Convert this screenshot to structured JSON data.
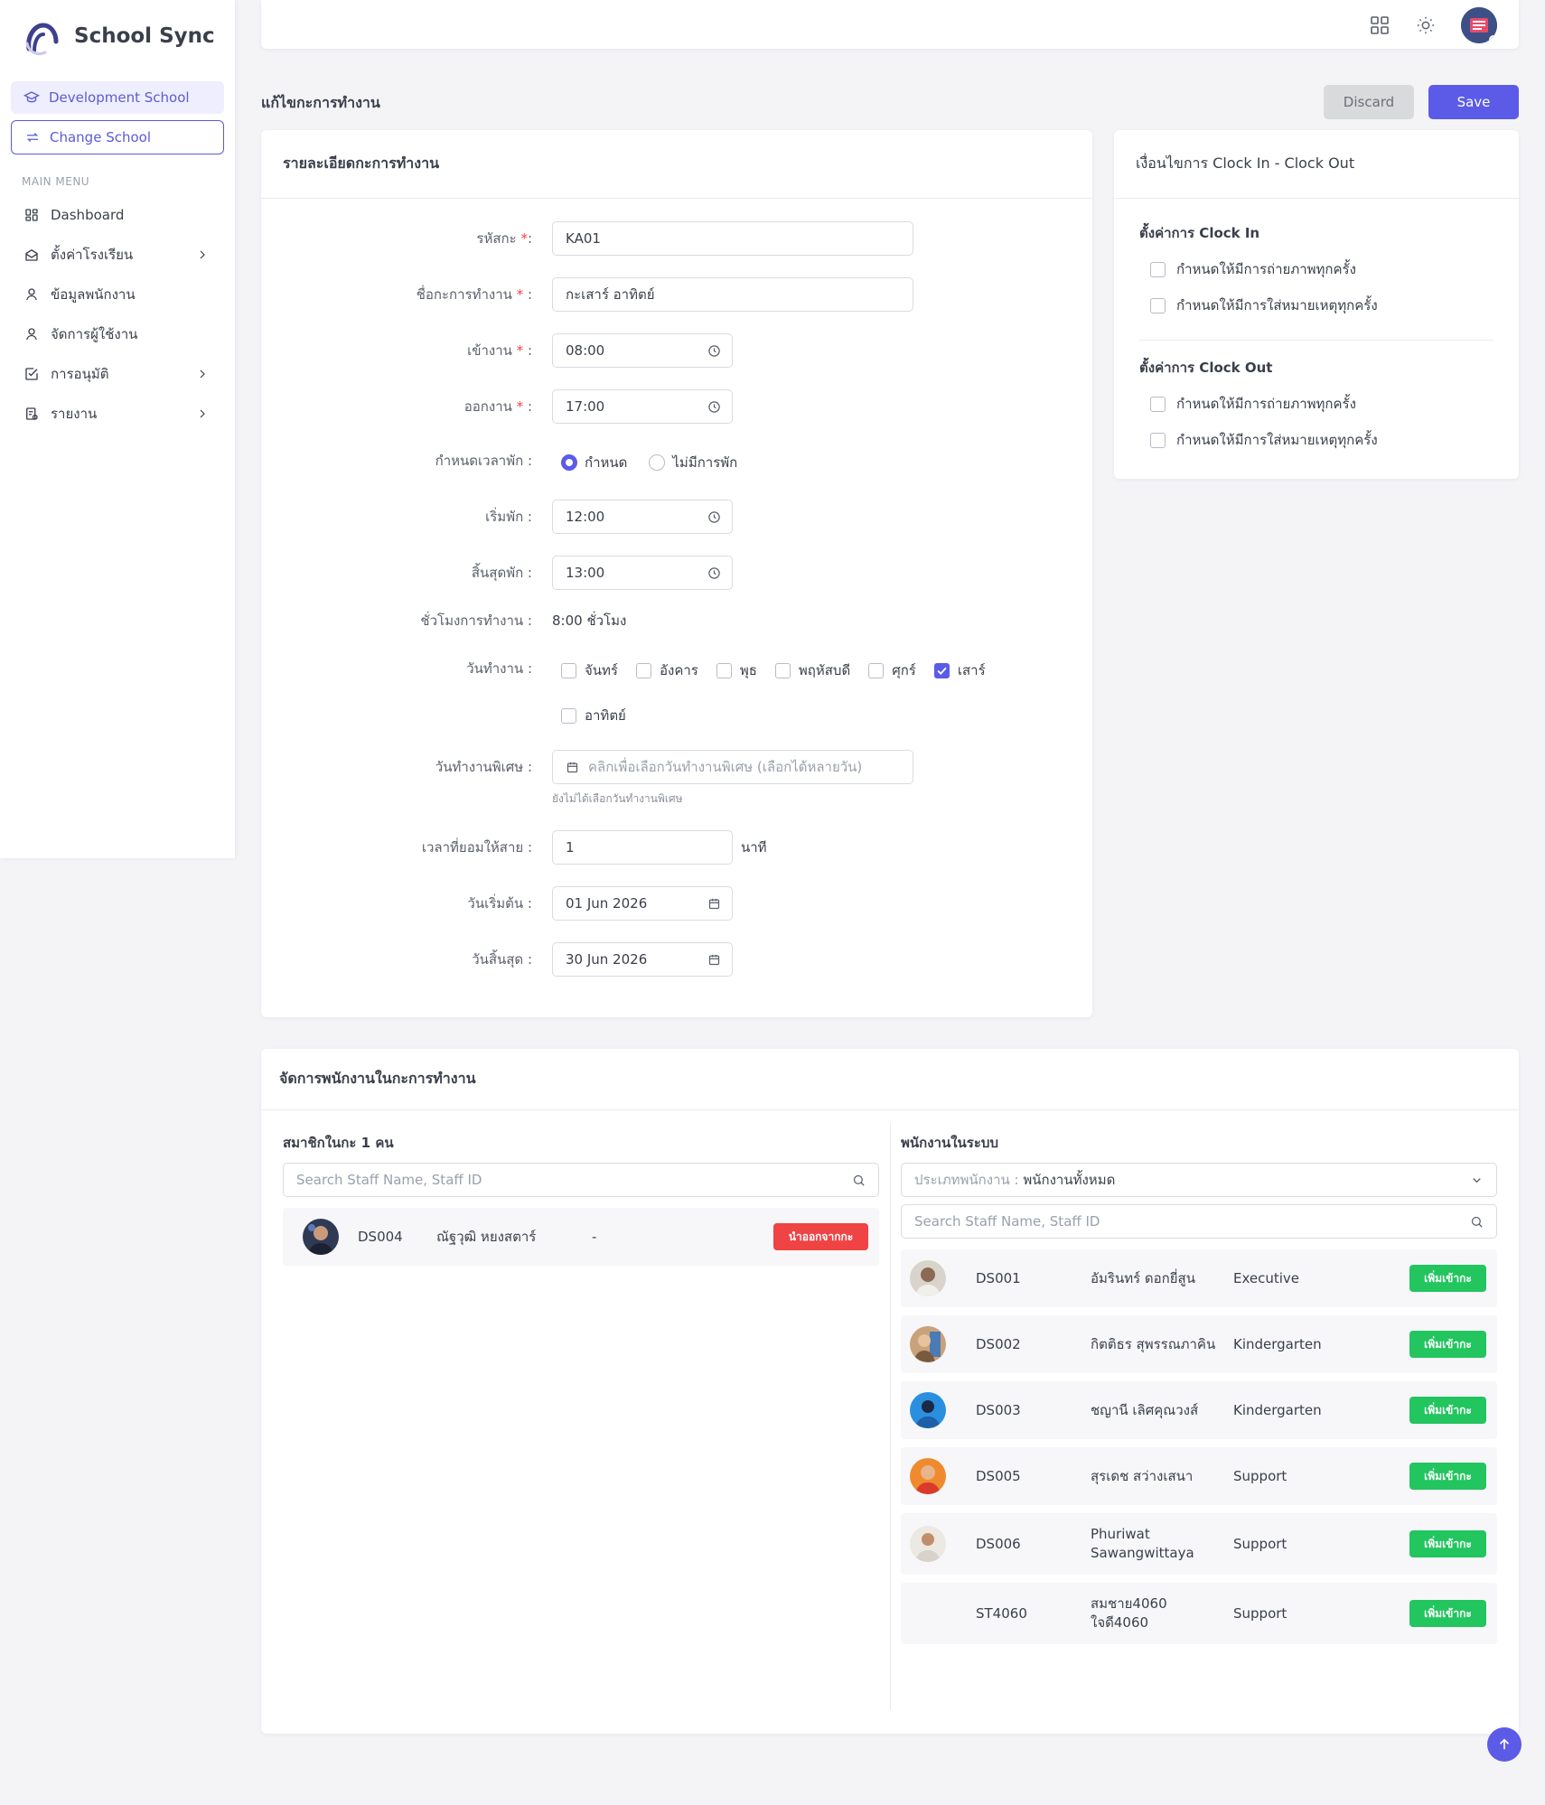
{
  "brand": {
    "name": "School Sync"
  },
  "sidebar": {
    "school": "Development School",
    "change_school": "Change School",
    "menu_heading": "MAIN MENU",
    "items": [
      {
        "label": "Dashboard"
      },
      {
        "label": "ตั้งค่าโรงเรียน"
      },
      {
        "label": "ข้อมูลพนักงาน"
      },
      {
        "label": "จัดการผู้ใช้งาน"
      },
      {
        "label": "การอนุมัติ"
      },
      {
        "label": "รายงาน"
      }
    ]
  },
  "header": {
    "title": "แก้ไขกะการทำงาน",
    "discard": "Discard",
    "save": "Save"
  },
  "details": {
    "title": "รายละเอียดกะการทำงาน",
    "code_label": "รหัสกะ",
    "code_value": "KA01",
    "name_label": "ชื่อกะการทำงาน",
    "name_value": "กะเสาร์ อาทิตย์",
    "start_label": "เข้างาน",
    "start_value": "08:00",
    "end_label": "ออกงาน",
    "end_value": "17:00",
    "break_label": "กำหนดเวลาพัก :",
    "break_opt_set": "กำหนด",
    "break_opt_none": "ไม่มีการพัก",
    "break_start_label": "เริ่มพัก :",
    "break_start_value": "12:00",
    "break_end_label": "สิ้นสุดพัก :",
    "break_end_value": "13:00",
    "hours_label": "ชั่วโมงการทำงาน :",
    "hours_value": "8:00 ชั่วโมง",
    "days_label": "วันทำงาน :",
    "days": [
      {
        "label": "จันทร์",
        "checked": false
      },
      {
        "label": "อังคาร",
        "checked": false
      },
      {
        "label": "พุธ",
        "checked": false
      },
      {
        "label": "พฤหัสบดี",
        "checked": false
      },
      {
        "label": "ศุกร์",
        "checked": false
      },
      {
        "label": "เสาร์",
        "checked": true
      },
      {
        "label": "อาทิตย์",
        "checked": false
      }
    ],
    "special_label": "วันทำงานพิเศษ :",
    "special_placeholder": "คลิกเพื่อเลือกวันทำงานพิเศษ (เลือกได้หลายวัน)",
    "special_hint": "ยังไม่ได้เลือกวันทำงานพิเศษ",
    "late_label": "เวลาที่ยอมให้สาย :",
    "late_value": "1",
    "late_unit": "นาที",
    "date_start_label": "วันเริ่มต้น :",
    "date_start_value": "01 Jun 2026",
    "date_end_label": "วันสิ้นสุด :",
    "date_end_value": "30 Jun 2026"
  },
  "conditions": {
    "title": "เงื่อนไขการ Clock In - Clock Out",
    "clock_in_title": "ตั้งค่าการ Clock In",
    "clock_out_title": "ตั้งค่าการ Clock Out",
    "photo_label": "กำหนดให้มีการถ่ายภาพทุกครั้ง",
    "note_label": "กำหนดให้มีการใส่หมายเหตุทุกครั้ง"
  },
  "staff": {
    "title": "จัดการพนักงานในกะการทำงาน",
    "members_title": "สมาชิกในกะ 1 คน",
    "search_placeholder": "Search Staff Name, Staff ID",
    "members": [
      {
        "id": "DS004",
        "name": "ณัฐวุฒิ หยงสตาร์",
        "dept": "-",
        "action": "นำออกจากกะ"
      }
    ],
    "system_title": "พนักงานในระบบ",
    "type_prefix": "ประเภทพนักงาน :",
    "type_value": "พนักงานทั้งหมด",
    "add_label": "เพิ่มเข้ากะ",
    "system": [
      {
        "id": "DS001",
        "name": "อัมรินทร์ ดอกยี่สูน",
        "dept": "Executive"
      },
      {
        "id": "DS002",
        "name": "กิตติธร สุพรรณภาคิน",
        "dept": "Kindergarten"
      },
      {
        "id": "DS003",
        "name": "ชญานี เลิศคุณวงส์",
        "dept": "Kindergarten"
      },
      {
        "id": "DS005",
        "name": "สุรเดช สว่างเสนา",
        "dept": "Support"
      },
      {
        "id": "DS006",
        "name": "Phuriwat Sawangwittaya",
        "dept": "Support"
      },
      {
        "id": "ST4060",
        "name": "สมชาย4060 ใจดี4060",
        "dept": "Support"
      }
    ]
  },
  "colors": {
    "accent": "#5b5be8",
    "success": "#22c55e",
    "danger": "#f04343"
  }
}
